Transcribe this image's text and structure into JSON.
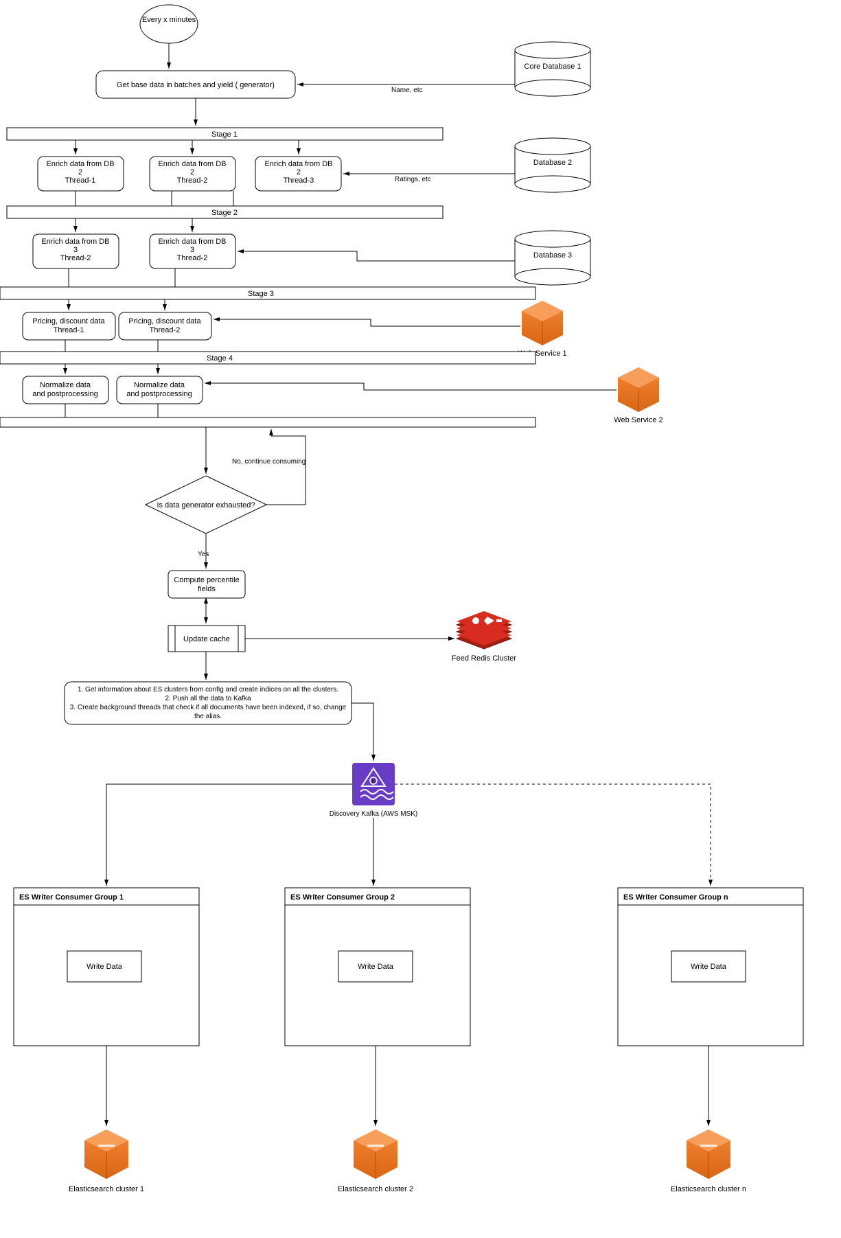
{
  "trigger": "Every x minutes",
  "getBase": "Get base data in batches and yield ( generator)",
  "labelNameEtc": "Name, etc",
  "coreDb1": "Core Database 1",
  "stage1": "Stage 1",
  "enrichDb2_t1_l1": "Enrich data from DB",
  "enrichDb2_t1_l2": "2",
  "enrichDb2_t1_l3": "Thread-1",
  "enrichDb2_t2_l1": "Enrich data from DB",
  "enrichDb2_t2_l2": "2",
  "enrichDb2_t2_l3": "Thread-2",
  "enrichDb2_t3_l1": "Enrich data from DB",
  "enrichDb2_t3_l2": "2",
  "enrichDb2_t3_l3": "Thread-3",
  "labelRatingsEtc": "Ratings, etc",
  "db2": "Database 2",
  "stage2": "Stage 2",
  "enrichDb3_a_l1": "Enrich data from DB",
  "enrichDb3_a_l2": "3",
  "enrichDb3_a_l3": "Thread-2",
  "enrichDb3_b_l1": "Enrich data from DB",
  "enrichDb3_b_l2": "3",
  "enrichDb3_b_l3": "Thread-2",
  "db3": "Database 3",
  "stage3": "Stage 3",
  "pricing_a_l1": "Pricing, discount data",
  "pricing_a_l2": "Thread-1",
  "pricing_b_l1": "Pricing, discount data",
  "pricing_b_l2": "Thread-2",
  "webService1": "Web Service 1",
  "stage4": "Stage 4",
  "normalize_a_l1": "Normalize data",
  "normalize_a_l2": "and postprocessing",
  "normalize_b_l1": "Normalize data",
  "normalize_b_l2": "and postprocessing",
  "webService2": "Web Service 2",
  "noContinue": "No, continue consuming",
  "decision": "Is data generator exhausted?",
  "yes": "Yes",
  "computePercentile_l1": "Compute percentile",
  "computePercentile_l2": "fields",
  "updateCache": "Update cache",
  "redisLabel": "Feed Redis Cluster",
  "esConfig_l1": "1. Get information about ES clusters from config and create indices on all the clusters.",
  "esConfig_l2": "2. Push all the data to Kafka",
  "esConfig_l3": "3. Create background threads that check if all documents have been indexed, if so, change",
  "esConfig_l4": "the alias.",
  "kafkaLabel": "Discovery Kafka (AWS MSK)",
  "consumerGroup1": "ES Writer Consumer Group 1",
  "consumerGroup2": "ES Writer Consumer Group 2",
  "consumerGroupN": "ES Writer Consumer Group n",
  "writeData": "Write Data",
  "esCluster1": "Elasticsearch cluster 1",
  "esCluster2": "Elasticsearch cluster 2",
  "esClusterN": "Elasticsearch cluster n"
}
